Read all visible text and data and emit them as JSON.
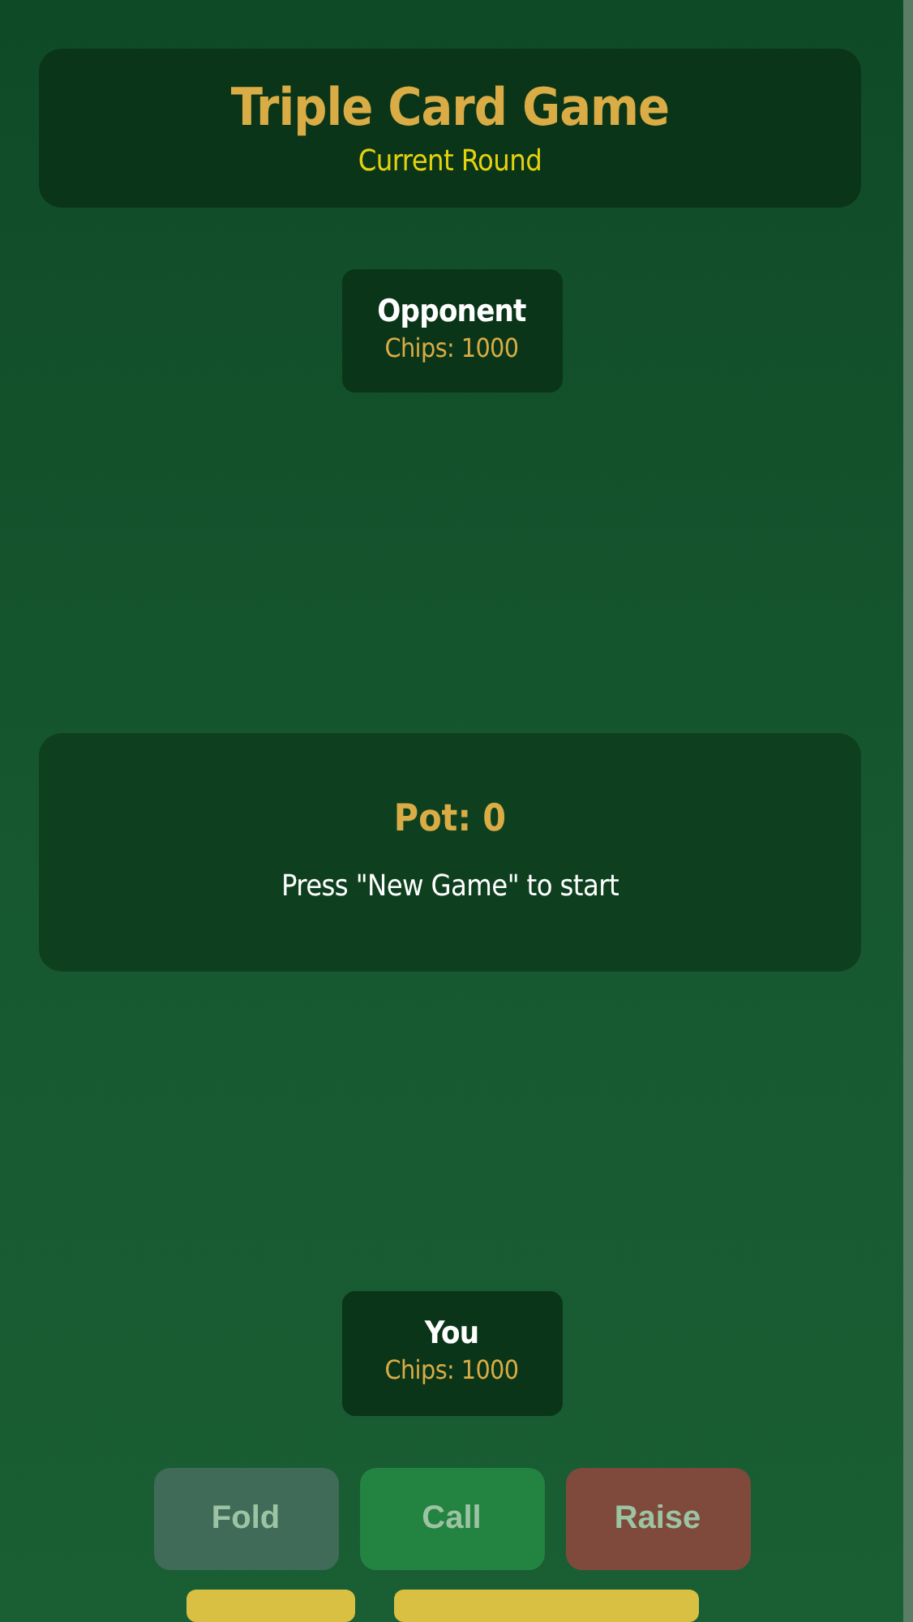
{
  "header": {
    "title": "Triple Card Game",
    "subtitle": "Current Round"
  },
  "opponent": {
    "name": "Opponent",
    "chips": "Chips: 1000"
  },
  "pot": {
    "amount": "Pot: 0",
    "message": "Press \"New Game\" to start"
  },
  "player": {
    "name": "You",
    "chips": "Chips: 1000"
  },
  "actions": [
    {
      "label": "Fold",
      "kind": "fold",
      "disabled": true
    },
    {
      "label": "Call",
      "kind": "call",
      "disabled": true
    },
    {
      "label": "Raise",
      "kind": "raise",
      "disabled": true
    }
  ]
}
